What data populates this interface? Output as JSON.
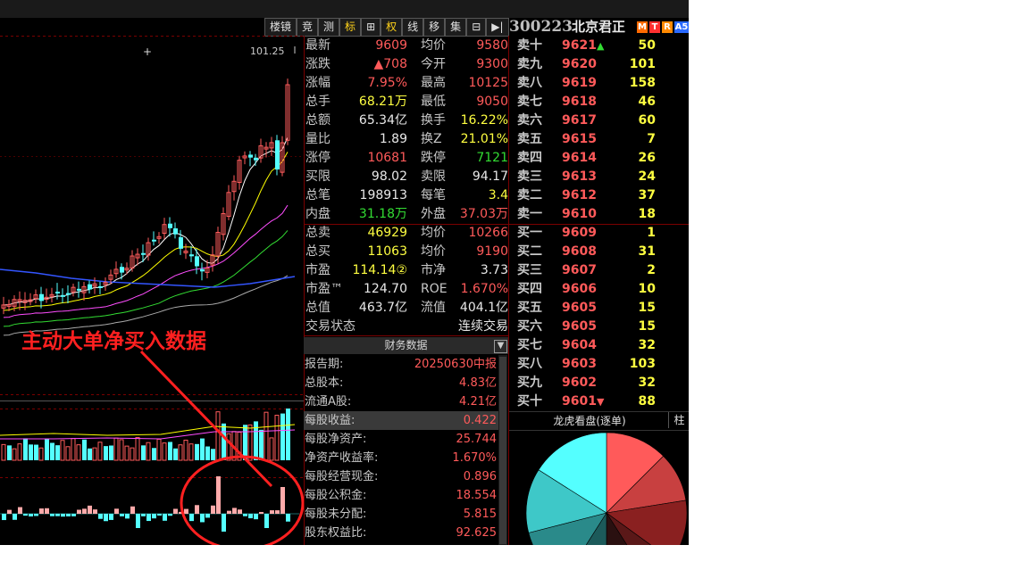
{
  "toolbar": {
    "buttons": [
      "楼镜",
      "竞",
      "测",
      "标",
      "⊞",
      "权",
      "线",
      "移",
      "集",
      "⊟",
      "▶|"
    ]
  },
  "stock": {
    "code": "300223",
    "name": "北京君正",
    "badges": [
      "M",
      "T",
      "R",
      "A5"
    ]
  },
  "chart": {
    "price_max_label": "101.25",
    "annotation": "主动大单净买入数据",
    "colors": {
      "up": "#ff5c5c",
      "down": "#54ffff",
      "ma5": "#ffffff",
      "ma10": "#ffff00",
      "ma20": "#ff4dff",
      "ma30": "#33dd33",
      "ma60": "#aaaaaa",
      "ma120": "#3355ff",
      "circle": "#ff2020"
    }
  },
  "quote": {
    "rows": [
      {
        "l1": "最新",
        "v1": "9609",
        "c1": "red",
        "l2": "均价",
        "v2": "9580",
        "c2": "red"
      },
      {
        "l1": "涨跌",
        "v1": "▲708",
        "c1": "red",
        "l2": "今开",
        "v2": "9300",
        "c2": "red"
      },
      {
        "l1": "涨幅",
        "v1": "7.95%",
        "c1": "red",
        "l2": "最高",
        "v2": "10125",
        "c2": "red"
      },
      {
        "l1": "总手",
        "v1": "68.21万",
        "c1": "yel",
        "l2": "最低",
        "v2": "9050",
        "c2": "red"
      },
      {
        "l1": "总额",
        "v1": "65.34亿",
        "c1": "wht",
        "l2": "换手",
        "v2": "16.22%",
        "c2": "yel"
      },
      {
        "l1": "量比",
        "v1": "1.89",
        "c1": "wht",
        "l2": "换Z",
        "v2": "21.01%",
        "c2": "yel"
      },
      {
        "l1": "涨停",
        "v1": "10681",
        "c1": "red",
        "l2": "跌停",
        "v2": "7121",
        "c2": "grn"
      },
      {
        "l1": "买限",
        "v1": "98.02",
        "c1": "wht",
        "l2": "卖限",
        "v2": "94.17",
        "c2": "wht"
      },
      {
        "l1": "总笔",
        "v1": "198913",
        "c1": "wht",
        "l2": "每笔",
        "v2": "3.4",
        "c2": "yel"
      },
      {
        "l1": "内盘",
        "v1": "31.18万",
        "c1": "grn",
        "l2": "外盘",
        "v2": "37.03万",
        "c2": "red"
      },
      {
        "l1": "总卖",
        "v1": "46929",
        "c1": "yel",
        "l2": "均价",
        "v2": "10266",
        "c2": "red"
      },
      {
        "l1": "总买",
        "v1": "11063",
        "c1": "yel",
        "l2": "均价",
        "v2": "9190",
        "c2": "red"
      },
      {
        "l1": "市盈",
        "v1": "114.14②",
        "c1": "yel",
        "l2": "市净",
        "v2": "3.73",
        "c2": "wht"
      },
      {
        "l1": "市盈™",
        "v1": "124.70",
        "c1": "wht",
        "l2": "ROE",
        "v2": "1.670%",
        "c2": "red"
      },
      {
        "l1": "总值",
        "v1": "463.7亿",
        "c1": "wht",
        "l2": "流值",
        "v2": "404.1亿",
        "c2": "wht"
      },
      {
        "l1": "交易状态",
        "v1": "",
        "c1": "wht",
        "l2": "",
        "v2": "连续交易",
        "c2": "wht"
      }
    ]
  },
  "financial": {
    "title": "财务数据",
    "rows": [
      {
        "label": "报告期:",
        "value": "20250630中报"
      },
      {
        "label": "总股本:",
        "value": "4.83亿"
      },
      {
        "label": "流通A股:",
        "value": "4.21亿"
      },
      {
        "label": "每股收益:",
        "value": "0.422"
      },
      {
        "label": "每股净资产:",
        "value": "25.744"
      },
      {
        "label": "净资产收益率:",
        "value": "1.670%"
      },
      {
        "label": "每股经营现金:",
        "value": "0.896"
      },
      {
        "label": "每股公积金:",
        "value": "18.554"
      },
      {
        "label": "每股未分配:",
        "value": "5.815"
      },
      {
        "label": "股东权益比:",
        "value": "92.625"
      }
    ]
  },
  "orderbook": {
    "asks": [
      {
        "label": "卖十",
        "price": "9621",
        "vol": "50"
      },
      {
        "label": "卖九",
        "price": "9620",
        "vol": "101"
      },
      {
        "label": "卖八",
        "price": "9619",
        "vol": "158"
      },
      {
        "label": "卖七",
        "price": "9618",
        "vol": "46"
      },
      {
        "label": "卖六",
        "price": "9617",
        "vol": "60"
      },
      {
        "label": "卖五",
        "price": "9615",
        "vol": "7"
      },
      {
        "label": "卖四",
        "price": "9614",
        "vol": "26"
      },
      {
        "label": "卖三",
        "price": "9613",
        "vol": "24"
      },
      {
        "label": "卖二",
        "price": "9612",
        "vol": "37"
      },
      {
        "label": "卖一",
        "price": "9610",
        "vol": "18"
      }
    ],
    "bids": [
      {
        "label": "买一",
        "price": "9609",
        "vol": "1"
      },
      {
        "label": "买二",
        "price": "9608",
        "vol": "31"
      },
      {
        "label": "买三",
        "price": "9607",
        "vol": "2"
      },
      {
        "label": "买四",
        "price": "9606",
        "vol": "10"
      },
      {
        "label": "买五",
        "price": "9605",
        "vol": "15"
      },
      {
        "label": "买六",
        "price": "9605",
        "vol": "15"
      },
      {
        "label": "买七",
        "price": "9604",
        "vol": "32"
      },
      {
        "label": "买八",
        "price": "9603",
        "vol": "103"
      },
      {
        "label": "买九",
        "price": "9602",
        "vol": "32"
      },
      {
        "label": "买十",
        "price": "9601",
        "vol": "88"
      }
    ]
  },
  "longhu": {
    "title": "龙虎看盘(逐单)",
    "button": "柱",
    "slice_colors": [
      "#ff5a5a",
      "#c84040",
      "#8a2020",
      "#5a1818",
      "#2a1010",
      "#1c5a5a",
      "#2a8a8a",
      "#3ec8c8",
      "#54ffff"
    ],
    "slice_values": [
      12.5,
      10,
      12.5,
      6,
      9,
      9,
      12,
      13,
      16
    ]
  }
}
